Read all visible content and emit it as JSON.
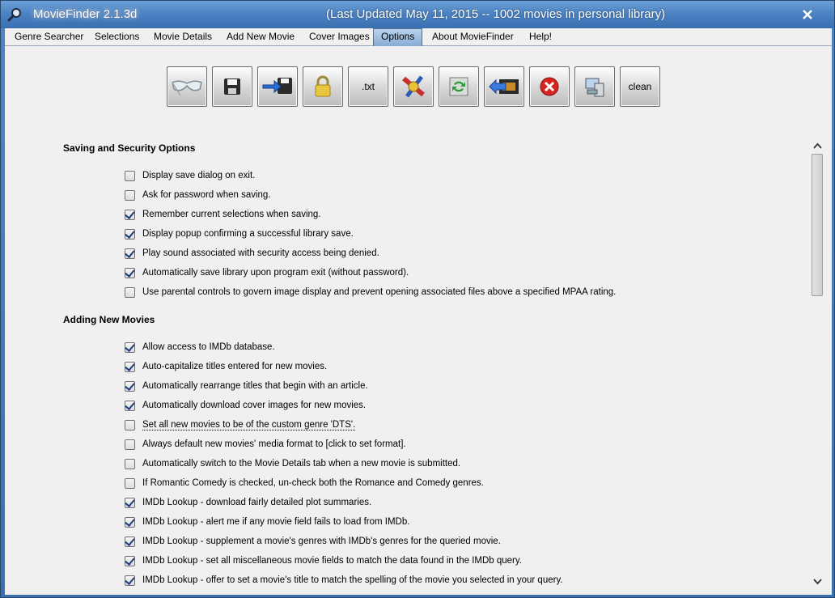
{
  "window": {
    "app_title": "MovieFinder 2.1.3d",
    "status": "(Last Updated May 11, 2015 -- 1002 movies in personal library)"
  },
  "tabs": [
    {
      "label": "Genre Searcher"
    },
    {
      "label": "Selections"
    },
    {
      "label": "Movie Details"
    },
    {
      "label": "Add New Movie"
    },
    {
      "label": "Cover Images"
    },
    {
      "label": "Options"
    },
    {
      "label": "About MovieFinder"
    },
    {
      "label": "Help!"
    }
  ],
  "toolbar": {
    "txt_label": ".txt",
    "clean_label": "clean",
    "icons": [
      "glasses-icon",
      "floppy-disk-icon",
      "save-arrow-icon",
      "padlock-icon",
      "txt-icon",
      "film-reel-icon",
      "refresh-icon",
      "film-arrow-icon",
      "red-x-icon",
      "computer-icon",
      "clean-icon"
    ]
  },
  "sections": {
    "saving": {
      "title": "Saving and Security Options",
      "options": [
        {
          "label": "Display save dialog on exit.",
          "checked": false
        },
        {
          "label": "Ask for password when saving.",
          "checked": false
        },
        {
          "label": "Remember current selections when saving.",
          "checked": true
        },
        {
          "label": "Display popup confirming a successful library save.",
          "checked": true
        },
        {
          "label": "Play sound associated with security access being denied.",
          "checked": true
        },
        {
          "label": "Automatically save library upon program exit (without password).",
          "checked": true
        },
        {
          "label": "Use parental controls to govern image display and prevent opening associated files above a specified MPAA rating.",
          "checked": false
        }
      ]
    },
    "adding": {
      "title": "Adding New Movies",
      "options": [
        {
          "label": "Allow access to IMDb database.",
          "checked": true
        },
        {
          "label": "Auto-capitalize titles entered for new movies.",
          "checked": true
        },
        {
          "label": "Automatically rearrange titles that begin with an article.",
          "checked": true
        },
        {
          "label": "Automatically download cover images for new movies.",
          "checked": true
        },
        {
          "label": "Set all new movies to be of the custom genre 'DTS'.",
          "checked": false
        },
        {
          "label": "Always default new movies' media format to [click to set format].",
          "checked": false
        },
        {
          "label": "Automatically switch to the Movie Details tab when a new movie is submitted.",
          "checked": false
        },
        {
          "label": "If Romantic Comedy is checked, un-check both the Romance and Comedy genres.",
          "checked": false
        },
        {
          "label": "IMDb Lookup - download fairly detailed plot summaries.",
          "checked": true
        },
        {
          "label": "IMDb Lookup - alert me if any movie field fails to load from IMDb.",
          "checked": true
        },
        {
          "label": "IMDb Lookup - supplement a movie's genres with IMDb's genres for the queried movie.",
          "checked": true
        },
        {
          "label": "IMDb Lookup - set all miscellaneous movie fields to match the data found in the IMDb query.",
          "checked": true
        },
        {
          "label": "IMDb Lookup - offer to set a movie's title to match the spelling of the movie you selected in your query.",
          "checked": true
        }
      ]
    }
  },
  "colors": {
    "title_bar": "#4c83c3",
    "active_tab": "#9fbfe2",
    "content_bg": "#f0f0f0"
  }
}
